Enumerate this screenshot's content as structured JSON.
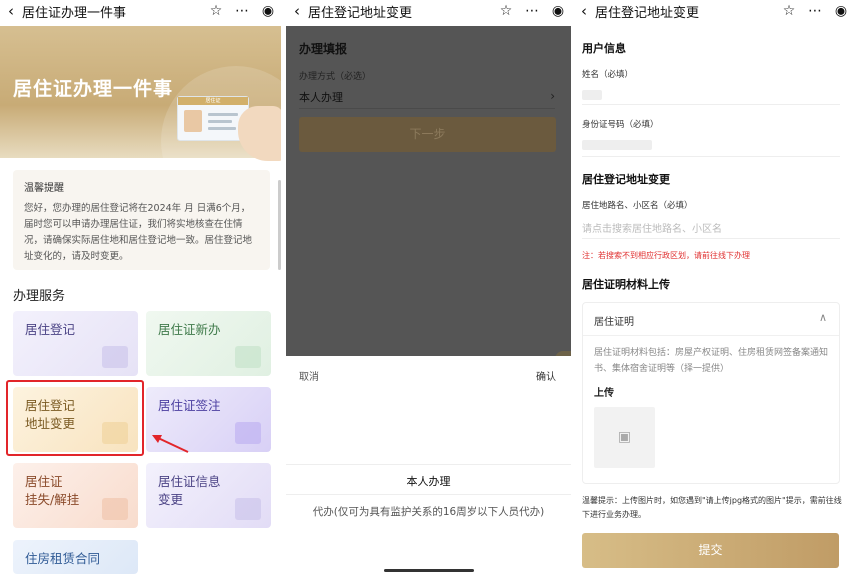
{
  "screen1": {
    "title": "居住证办理一件事",
    "banner_title": "居住证办理一件事",
    "card_label": "居住证",
    "tip_title": "温馨提醒",
    "tip_body": "您好，您办理的居住登记将在2024年 月 日满6个月，届时您可以申请办理居住证，我们将实地核查在住情况，请确保实际居住地和居住登记地一致。居住登记地址变化的，请及时变更。",
    "section": "办理服务",
    "tiles": [
      {
        "label": "居住登记"
      },
      {
        "label": "居住证新办"
      },
      {
        "label": "居住登记\n地址变更"
      },
      {
        "label": "居住证签注"
      },
      {
        "label": "居住证\n挂失/解挂"
      },
      {
        "label": "居住证信息\n变更"
      },
      {
        "label": "住房租赁合同"
      }
    ]
  },
  "screen2": {
    "title": "居住登记地址变更",
    "form_heading": "办理填报",
    "method_label": "办理方式（必选）",
    "method_value": "本人办理",
    "next_button": "下一步",
    "cancel": "取消",
    "confirm": "确认",
    "option1": "本人办理",
    "option2": "代办(仅可为具有监护关系的16周岁以下人员代办)"
  },
  "screen3": {
    "title": "居住登记地址变更",
    "user_info": "用户信息",
    "name_label": "姓名（必填）",
    "id_label": "身份证号码（必填）",
    "addr_heading": "居住登记地址变更",
    "addr_label": "居住地路名、小区名（必填）",
    "addr_placeholder": "请点击搜索居住地路名、小区名",
    "addr_warning": "注：若搜索不到相应行政区划，请前往线下办理",
    "upload_heading": "居住证明材料上传",
    "proof_title": "居住证明",
    "proof_desc": "居住证明材料包括：房屋产权证明、住房租赁网签备案通知书、集体宿舍证明等（择一提供）",
    "upload_label": "上传",
    "hint": "温馨提示：上传图片时，如您遇到\"请上传jpg格式的图片\"提示，需前往线下进行业务办理。",
    "submit": "提交"
  },
  "colors": {
    "accent": "#c8a66e",
    "highlight": "#e2252a",
    "warning": "#e03030"
  }
}
